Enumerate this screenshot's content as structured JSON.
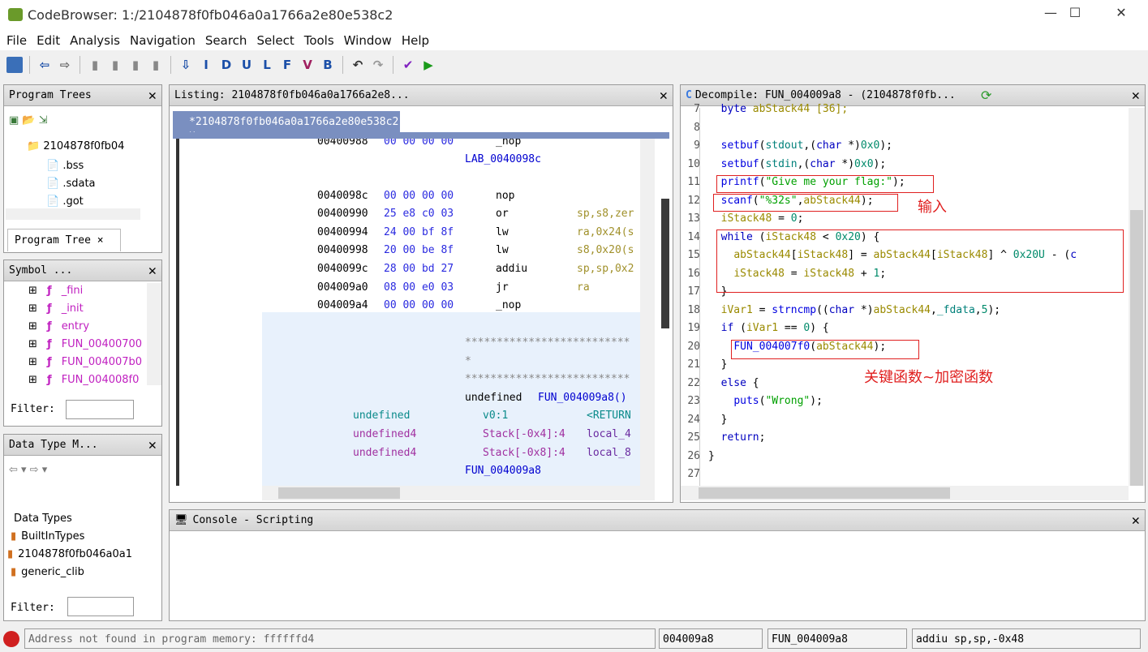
{
  "window": {
    "title": "CodeBrowser: 1:/2104878f0fb046a0a1766a2e80e538c2",
    "minimize": "—",
    "maximize": "☐",
    "close": "✕"
  },
  "menu": [
    "File",
    "Edit",
    "Analysis",
    "Navigation",
    "Search",
    "Select",
    "Tools",
    "Window",
    "Help"
  ],
  "toolbar": [
    "save",
    "back",
    "forward",
    "I",
    "D",
    "U",
    "L",
    "F",
    "V",
    "B"
  ],
  "program_trees": {
    "title": "Program Trees",
    "root": "2104878f0fb04",
    "items": [
      ".bss",
      ".sdata",
      ".got"
    ],
    "tab": "Program Tree",
    "tab_close": "×"
  },
  "symbol_tree": {
    "title": "Symbol ...",
    "items": [
      "_fini",
      "_init",
      "entry",
      "FUN_00400700",
      "FUN_004007b0",
      "FUN_004008f0"
    ],
    "filter_label": "Filter:"
  },
  "data_types": {
    "title": "Data Type M...",
    "items": [
      "Data Types",
      "BuiltInTypes",
      "2104878f0fb046a0a1",
      "generic_clib"
    ],
    "filter_label": "Filter:"
  },
  "listing": {
    "title": "Listing:  2104878f0fb046a0a1766a2e8...",
    "tab": "*2104878f0fb046a0a1766a2e80e538c2",
    "rows": [
      {
        "addr": "00400988",
        "bytes": "00 00 00 00",
        "mn": "_nop",
        "op": ""
      },
      {
        "label": "LAB_0040098c"
      },
      {
        "addr": "0040098c",
        "bytes": "00 00 00 00",
        "mn": "nop",
        "op": ""
      },
      {
        "addr": "00400990",
        "bytes": "25 e8 c0 03",
        "mn": "or",
        "op": "sp,s8,zer"
      },
      {
        "addr": "00400994",
        "bytes": "24 00 bf 8f",
        "mn": "lw",
        "op": "ra,0x24(s"
      },
      {
        "addr": "00400998",
        "bytes": "20 00 be 8f",
        "mn": "lw",
        "op": "s8,0x20(s"
      },
      {
        "addr": "0040099c",
        "bytes": "28 00 bd 27",
        "mn": "addiu",
        "op": "sp,sp,0x2"
      },
      {
        "addr": "004009a0",
        "bytes": "08 00 e0 03",
        "mn": "jr",
        "op": "ra"
      },
      {
        "addr": "004009a4",
        "bytes": "00 00 00 00",
        "mn": "_nop",
        "op": ""
      }
    ],
    "stars1": "**************************",
    "stars2": "*",
    "stars3": "**************************",
    "sig": "undefined ",
    "sig_fn": "FUN_004009a8()",
    "params": [
      [
        "undefined",
        "v0:1",
        "<RETURN"
      ],
      [
        "undefined4",
        "Stack[-0x4]:4",
        "local_4"
      ],
      [
        "undefined4",
        "Stack[-0x8]:4",
        "local_8"
      ]
    ],
    "fn_label": "FUN_004009a8"
  },
  "decompile": {
    "title": "Decompile: FUN_004009a8 -  (2104878f0fb...",
    "lines": [
      {
        "n": "7",
        "t": [
          [
            "  ",
            "plain"
          ],
          [
            "byte",
            "type"
          ],
          [
            " abStack44 [36];",
            "var"
          ]
        ]
      },
      {
        "n": "8",
        "t": []
      },
      {
        "n": "9",
        "t": [
          [
            "  ",
            "plain"
          ],
          [
            "setbuf",
            "fn"
          ],
          [
            "(",
            "plain"
          ],
          [
            "stdout",
            "param"
          ],
          [
            ",(",
            "plain"
          ],
          [
            "char",
            "type"
          ],
          [
            " *)",
            "plain"
          ],
          [
            "0x0",
            "num"
          ],
          [
            ");",
            "plain"
          ]
        ]
      },
      {
        "n": "10",
        "t": [
          [
            "  ",
            "plain"
          ],
          [
            "setbuf",
            "fn"
          ],
          [
            "(",
            "plain"
          ],
          [
            "stdin",
            "param"
          ],
          [
            ",(",
            "plain"
          ],
          [
            "char",
            "type"
          ],
          [
            " *)",
            "plain"
          ],
          [
            "0x0",
            "num"
          ],
          [
            ");",
            "plain"
          ]
        ]
      },
      {
        "n": "11",
        "t": [
          [
            "  ",
            "plain"
          ],
          [
            "printf",
            "fn"
          ],
          [
            "(",
            "plain"
          ],
          [
            "\"Give me your flag:\"",
            "str"
          ],
          [
            ");",
            "plain"
          ]
        ]
      },
      {
        "n": "12",
        "t": [
          [
            "  ",
            "plain"
          ],
          [
            "scanf",
            "fn"
          ],
          [
            "(",
            "plain"
          ],
          [
            "\"%32s\"",
            "str"
          ],
          [
            ",",
            "plain"
          ],
          [
            "abStack44",
            "var"
          ],
          [
            ");",
            "plain"
          ]
        ]
      },
      {
        "n": "13",
        "t": [
          [
            "  ",
            "plain"
          ],
          [
            "iStack48",
            "var"
          ],
          [
            " = ",
            "plain"
          ],
          [
            "0",
            "num"
          ],
          [
            ";",
            "plain"
          ]
        ]
      },
      {
        "n": "14",
        "t": [
          [
            "  ",
            "plain"
          ],
          [
            "while",
            "kw"
          ],
          [
            " (",
            "plain"
          ],
          [
            "iStack48",
            "var"
          ],
          [
            " < ",
            "plain"
          ],
          [
            "0x20",
            "num"
          ],
          [
            ") {",
            "plain"
          ]
        ]
      },
      {
        "n": "15",
        "t": [
          [
            "    ",
            "plain"
          ],
          [
            "abStack44",
            "var"
          ],
          [
            "[",
            "plain"
          ],
          [
            "iStack48",
            "var"
          ],
          [
            "] = ",
            "plain"
          ],
          [
            "abStack44",
            "var"
          ],
          [
            "[",
            "plain"
          ],
          [
            "iStack48",
            "var"
          ],
          [
            "] ^ ",
            "plain"
          ],
          [
            "0x20U",
            "num"
          ],
          [
            " - (",
            "plain"
          ],
          [
            "c",
            "type"
          ]
        ]
      },
      {
        "n": "16",
        "t": [
          [
            "    ",
            "plain"
          ],
          [
            "iStack48",
            "var"
          ],
          [
            " = ",
            "plain"
          ],
          [
            "iStack48",
            "var"
          ],
          [
            " + ",
            "plain"
          ],
          [
            "1",
            "num"
          ],
          [
            ";",
            "plain"
          ]
        ]
      },
      {
        "n": "17",
        "t": [
          [
            "  }",
            "plain"
          ]
        ]
      },
      {
        "n": "18",
        "t": [
          [
            "  ",
            "plain"
          ],
          [
            "iVar1",
            "var"
          ],
          [
            " = ",
            "plain"
          ],
          [
            "strncmp",
            "fn"
          ],
          [
            "((",
            "plain"
          ],
          [
            "char",
            "type"
          ],
          [
            " *)",
            "plain"
          ],
          [
            "abStack44",
            "var"
          ],
          [
            ",",
            "plain"
          ],
          [
            "_fdata",
            "param"
          ],
          [
            ",",
            "plain"
          ],
          [
            "5",
            "num"
          ],
          [
            ");",
            "plain"
          ]
        ]
      },
      {
        "n": "19",
        "t": [
          [
            "  ",
            "plain"
          ],
          [
            "if",
            "kw"
          ],
          [
            " (",
            "plain"
          ],
          [
            "iVar1",
            "var"
          ],
          [
            " == ",
            "plain"
          ],
          [
            "0",
            "num"
          ],
          [
            ") {",
            "plain"
          ]
        ]
      },
      {
        "n": "20",
        "t": [
          [
            "    ",
            "plain"
          ],
          [
            "FUN_004007f0",
            "fn"
          ],
          [
            "(",
            "plain"
          ],
          [
            "abStack44",
            "var"
          ],
          [
            ");",
            "plain"
          ]
        ]
      },
      {
        "n": "21",
        "t": [
          [
            "  }",
            "plain"
          ]
        ]
      },
      {
        "n": "22",
        "t": [
          [
            "  ",
            "plain"
          ],
          [
            "else",
            "kw"
          ],
          [
            " {",
            "plain"
          ]
        ]
      },
      {
        "n": "23",
        "t": [
          [
            "    ",
            "plain"
          ],
          [
            "puts",
            "fn"
          ],
          [
            "(",
            "plain"
          ],
          [
            "\"Wrong\"",
            "str"
          ],
          [
            ");",
            "plain"
          ]
        ]
      },
      {
        "n": "24",
        "t": [
          [
            "  }",
            "plain"
          ]
        ]
      },
      {
        "n": "25",
        "t": [
          [
            "  ",
            "plain"
          ],
          [
            "return",
            "kw"
          ],
          [
            ";",
            "plain"
          ]
        ]
      },
      {
        "n": "26",
        "t": [
          [
            "}",
            "plain"
          ]
        ]
      },
      {
        "n": "27",
        "t": []
      }
    ],
    "annotation_input": "输入",
    "annotation_key": "关键函数~加密函数",
    "annotation_color": "#e02020"
  },
  "console": {
    "title": "Console - Scripting"
  },
  "status": {
    "message": "Address not found in program memory: ffffffd4",
    "address": "004009a8",
    "function": "FUN_004009a8",
    "instruction": "addiu sp,sp,-0x48"
  }
}
